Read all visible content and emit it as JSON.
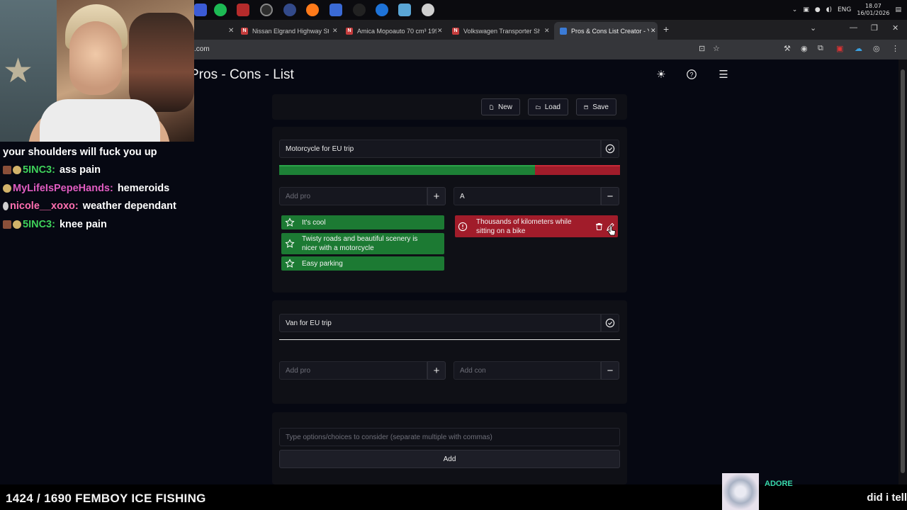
{
  "browser": {
    "tabs": [
      {
        "title": "Nissan Elgrand Highway Star / ...",
        "favicon": "N"
      },
      {
        "title": "Amica Mopoauto 70 cm³ 1997 ...",
        "favicon": "N"
      },
      {
        "title": "Volkswagen Transporter Short ...",
        "favicon": "N"
      },
      {
        "title": "Pros & Cons List Creator - Your",
        "favicon": "P"
      }
    ],
    "url": ".com",
    "tray": {
      "lang": "ENG",
      "time": "18.07",
      "date": "16/01/2026"
    }
  },
  "app": {
    "title": "Pros - Cons - List",
    "toolbar": {
      "new_label": "New",
      "load_label": "Load",
      "save_label": "Save"
    },
    "lists": [
      {
        "title": "Motorcycle for EU trip",
        "pro_ratio": 0.75,
        "add_pro_placeholder": "Add pro",
        "add_con_value": "A",
        "pros": [
          "It's cool",
          "Twisty roads and beautiful scenery is nicer with a motorcycle",
          "Easy parking"
        ],
        "cons": [
          "Thousands of kilometers while sitting on a bike"
        ]
      },
      {
        "title": "Van for EU trip",
        "add_pro_placeholder": "Add pro",
        "add_con_placeholder": "Add con",
        "pros": [],
        "cons": []
      }
    ],
    "options_placeholder": "Type options/choices to consider (separate multiple with commas)",
    "add_label": "Add"
  },
  "stream": {
    "chat": [
      {
        "user": "",
        "message": "your shoulders will fuck you up",
        "color": "#ffffff"
      },
      {
        "user": "5INC3:",
        "message": "ass pain",
        "color": "#3fd15a"
      },
      {
        "user": "MyLifeIsPepeHands:",
        "message": "hemeroids",
        "color": "#e05cc0"
      },
      {
        "user": "nicole__xoxo:",
        "message": "weather dependant",
        "color": "#ff6fb0"
      },
      {
        "user": "5INC3:",
        "message": "knee pain",
        "color": "#3fd15a"
      }
    ],
    "ticker": "1424 / 1690 FEMBOY ICE FISHING",
    "ticker_right": "did i tell",
    "now_playing": "ADORE"
  },
  "colors": {
    "pro": "#1c7a33",
    "con": "#a11c2a",
    "accent_chat_green": "#3fd15a"
  }
}
